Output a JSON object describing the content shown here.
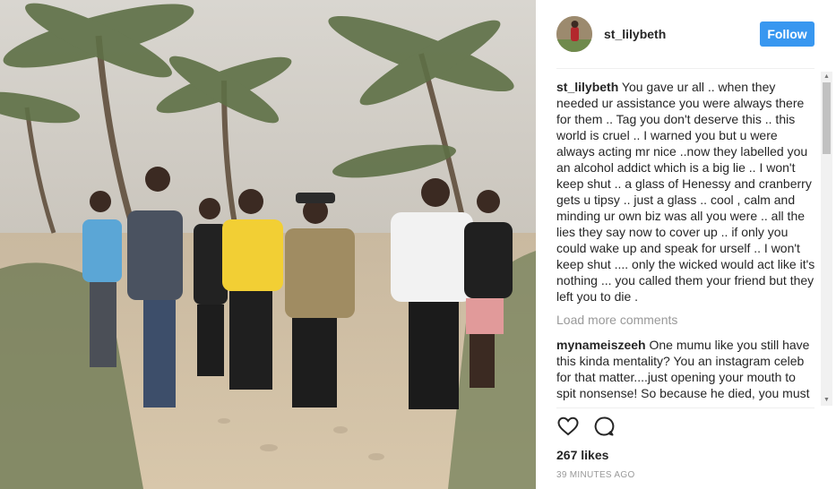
{
  "post": {
    "username": "st_lilybeth",
    "follow_label": "Follow",
    "caption": {
      "user": "st_lilybeth",
      "text": "You gave ur all .. when they needed ur assistance you were always there for them .. Tag you don't deserve this .. this world is cruel .. I warned you but u were always acting mr nice ..now they labelled you an alcohol addict which is a big lie .. I won't keep shut .. a glass of Henessy and cranberry gets u tipsy .. just a glass .. cool , calm and minding ur own biz was all you were .. all the lies they say now to cover up .. if only you could wake up and speak for urself .. I won't keep shut .... only the wicked would act like it's nothing ... you called them your friend but they left you to die ."
    },
    "load_more": "Load more comments",
    "comments": [
      {
        "user": "mynameiszeeh",
        "text": "One mumu like you still have this kinda mentality? You an instagram celeb for that matter....just opening your mouth to spit nonsense! So because he died, you must cause"
      }
    ],
    "likes": "267 likes",
    "time": "39 MINUTES AGO"
  },
  "icons": {
    "like": "heart-icon",
    "comment": "speech-bubble-icon"
  },
  "colors": {
    "follow_button": "#3897f0",
    "muted_text": "#999999"
  }
}
